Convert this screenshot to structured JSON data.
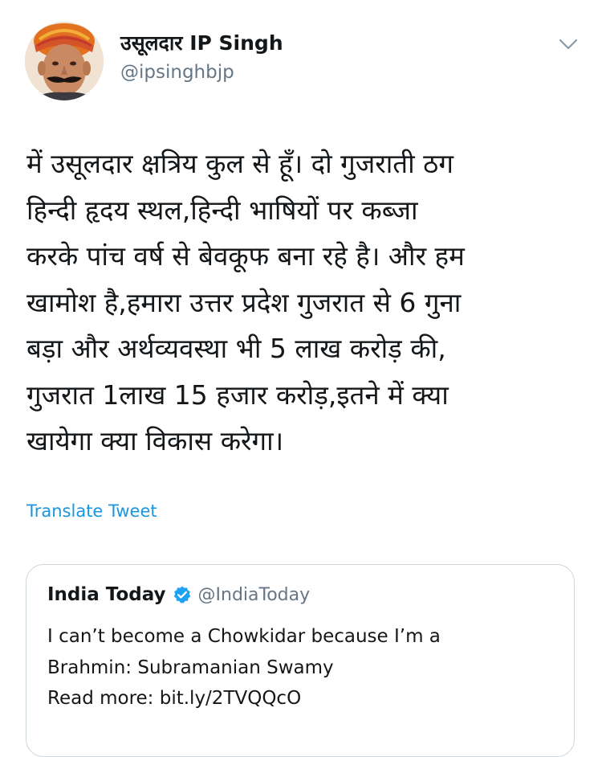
{
  "tweet": {
    "display_name": "उसूलदार IP Singh",
    "handle": "@ipsinghbjp",
    "body_lines": [
      "में उसूलदार क्षत्रिय कुल से हूँ। दो गुजराती ठग",
      "हिन्दी हृदय स्थल,हिन्दी भाषियों पर कब्जा",
      "करके पांच वर्ष से बेवकूफ बना रहे है। और हम",
      "खामोश है,हमारा उत्तर प्रदेश गुजरात से 6 गुना",
      "बड़ा और अर्थव्यवस्था भी 5 लाख करोड़ की,",
      "गुजरात 1लाख 15 हजार करोड़,इतने में क्या",
      "खायेगा क्या विकास करेगा।"
    ],
    "translate_label": "Translate Tweet"
  },
  "quoted_tweet": {
    "display_name": "India Today",
    "handle": "@IndiaToday",
    "text_lines": [
      "I can’t become a Chowkidar because I’m a",
      "Brahmin: Subramanian Swamy",
      "Read more: bit.ly/2TVQQcO"
    ]
  },
  "icons": {
    "avatar": "profile-photo",
    "menu": "chevron-down-icon",
    "verified": "verified-badge-icon"
  },
  "colors": {
    "link": "#1b95e0",
    "secondary_text": "#657786",
    "primary_text": "#14171a",
    "verified": "#1da1f2",
    "border": "#ccd6dd"
  }
}
